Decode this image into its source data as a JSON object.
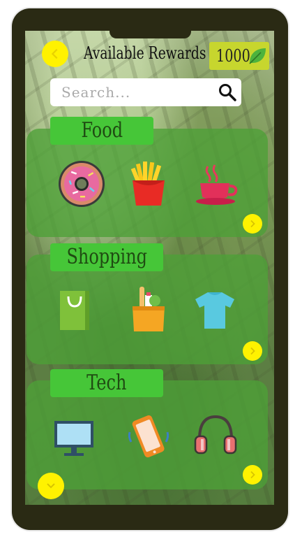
{
  "header": {
    "title": "Available Rewards",
    "points": "1000",
    "icons": {
      "back": "chevron-left-icon",
      "points": "leaf-icon"
    }
  },
  "search": {
    "placeholder": "Search...",
    "icon": "search-icon"
  },
  "categories": [
    {
      "label": "Food",
      "items": [
        "donut-icon",
        "fries-icon",
        "coffee-cup-icon"
      ]
    },
    {
      "label": "Shopping",
      "items": [
        "shopping-bag-icon",
        "grocery-bag-icon",
        "tshirt-icon"
      ]
    },
    {
      "label": "Tech",
      "items": [
        "monitor-icon",
        "smartphone-icon",
        "headphones-icon"
      ]
    }
  ],
  "colors": {
    "accent_yellow": "#fff200",
    "label_green": "#46c638",
    "points_green": "#c7d62e",
    "phone_frame": "#2a2a14"
  }
}
